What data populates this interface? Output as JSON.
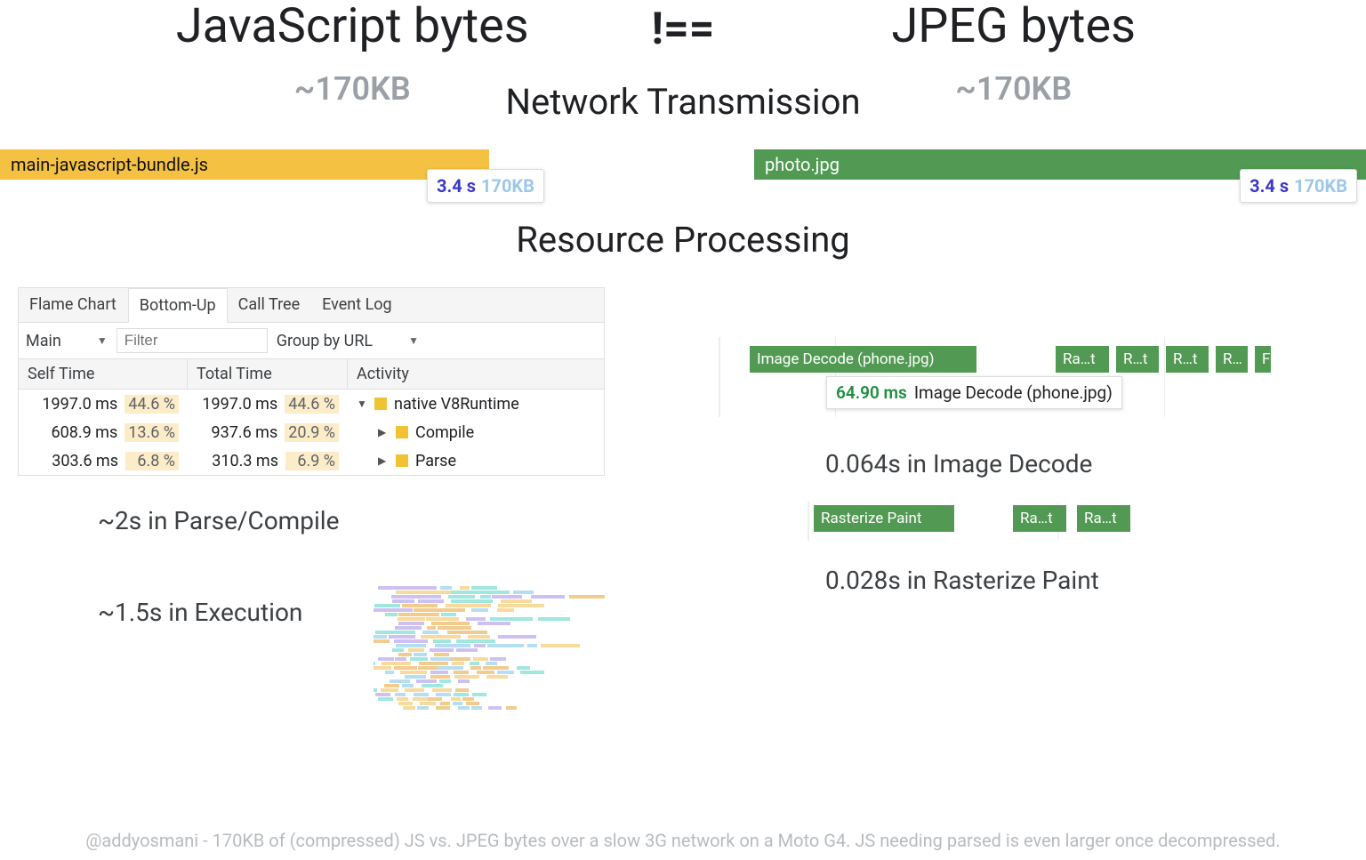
{
  "header": {
    "js_title": "JavaScript bytes",
    "neq": "!==",
    "jpeg_title": "JPEG bytes",
    "size_left": "~170KB",
    "size_right": "~170KB"
  },
  "sections": {
    "network": "Network Transmission",
    "processing": "Resource Processing"
  },
  "bars": {
    "js_label": "main-javascript-bundle.js",
    "jpeg_label": "photo.jpg",
    "tooltip_time": "3.4 s",
    "tooltip_size": "170KB"
  },
  "devtools": {
    "tabs": [
      "Flame Chart",
      "Bottom-Up",
      "Call Tree",
      "Event Log"
    ],
    "active_tab": "Bottom-Up",
    "thread": "Main",
    "filter_placeholder": "Filter",
    "group_label": "Group by URL",
    "headers": {
      "self": "Self Time",
      "total": "Total Time",
      "activity": "Activity"
    },
    "rows": [
      {
        "self_ms": "1997.0 ms",
        "self_pct": "44.6 %",
        "total_ms": "1997.0 ms",
        "total_pct": "44.6 %",
        "tri": "▼",
        "activity": "native V8Runtime"
      },
      {
        "self_ms": "608.9 ms",
        "self_pct": "13.6 %",
        "total_ms": "937.6 ms",
        "total_pct": "20.9 %",
        "tri": "▶",
        "activity": "Compile"
      },
      {
        "self_ms": "303.6 ms",
        "self_pct": "6.8 %",
        "total_ms": "310.3 ms",
        "total_pct": "6.9 %",
        "tri": "▶",
        "activity": "Parse"
      }
    ]
  },
  "left_summaries": {
    "parse_compile": "~2s in Parse/Compile",
    "execution": "~1.5s in Execution"
  },
  "right_timeline": {
    "decode_label": "Image Decode (phone.jpg)",
    "small_labels": [
      "Ra…t",
      "R…t",
      "R…t",
      "R…",
      "F"
    ],
    "tooltip_time": "64.90 ms",
    "tooltip_label": "Image Decode (phone.jpg)"
  },
  "right_summaries": {
    "decode": "0.064s in Image Decode",
    "raster": "0.028s in Rasterize Paint"
  },
  "raster_blocks": {
    "big": "Rasterize Paint",
    "small": [
      "Ra…t",
      "Ra…t"
    ]
  },
  "footnote": "@addyosmani - 170KB of (compressed) JS vs. JPEG bytes over a slow 3G network on a Moto G4. JS needing parsed is even larger once decompressed."
}
